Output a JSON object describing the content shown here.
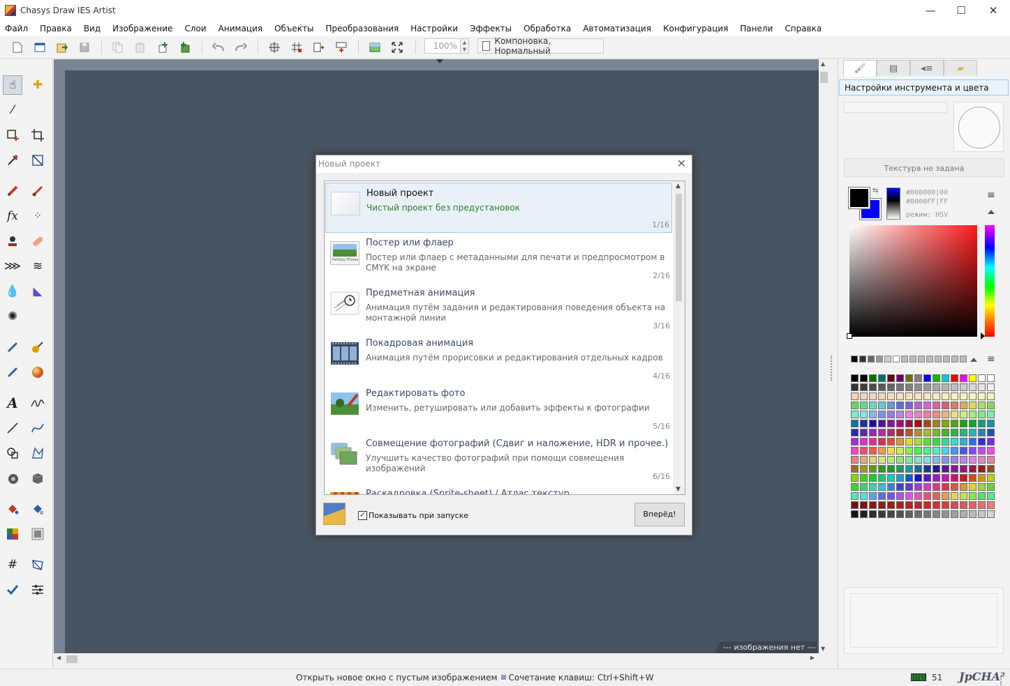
{
  "window": {
    "title": "Chasys Draw IES Artist",
    "minimize": "—",
    "maximize": "☐",
    "close": "✕"
  },
  "menu": [
    "Файл",
    "Правка",
    "Вид",
    "Изображение",
    "Слои",
    "Анимация",
    "Объекты",
    "Преобразования",
    "Настройки",
    "Эффекты",
    "Обработка",
    "Автоматизация",
    "Конфигурация",
    "Панели",
    "Справка"
  ],
  "toolbar": {
    "icons": [
      "new-file-icon",
      "open-window-icon",
      "import-icon",
      "save-icon",
      "copy-icon",
      "paste-icon",
      "new-layer-icon",
      "add-layer-icon",
      "undo-icon",
      "redo-icon",
      "grid-icon",
      "grid-add-icon",
      "layer-split-icon",
      "layer-merge-icon",
      "image-icon",
      "fit-screen-icon",
      "document-icon"
    ],
    "zoom": "100%",
    "mode": "Компоновка, Нормальный"
  },
  "tools": [
    "hand-icon",
    "plus-move-icon",
    "eyedropper-icon",
    "select-add-icon",
    "crop-icon",
    "pipette-icon",
    "transform-icon",
    "pencil-icon",
    "brush-icon",
    "fx-icon",
    "scatter-icon",
    "stamp-icon",
    "bandage-icon",
    "spray-icon",
    "wave-icon",
    "drop-icon",
    "cone-icon",
    "splash-icon",
    "marker-icon",
    "round-brush-icon",
    "blue-pen-icon",
    "sphere-icon",
    "text-icon",
    "signature-icon",
    "line-icon",
    "curve-icon",
    "shapes-icon",
    "polygon-icon",
    "camera-icon",
    "cube-icon",
    "fill-icon",
    "fill-pattern-icon",
    "gradient-icon",
    "gray-square-icon",
    "hash-grid-icon",
    "warp-icon",
    "check-brush-icon",
    "sliders-icon"
  ],
  "canvas": {
    "no_image": "--- изображения нет ---"
  },
  "statusbar": {
    "hint": "Открыть новое окно с пустым изображением",
    "shortcut": "Сочетание клавиш: Ctrl+Shift+W",
    "memory": "51",
    "brand": "JpCHA²"
  },
  "right_panel": {
    "tabs": [
      "tool-colors-icon",
      "layers-icon",
      "properties-icon",
      "folder-icon"
    ],
    "header": "Настройки инструмента и цвета",
    "texture": "Текстура не задана",
    "fg_hex": "#000000|00",
    "bg_hex": "#0000FF|FF",
    "mode": "режим: HSV",
    "colors": {
      "fg": "#000000",
      "bg": "#0000ff"
    }
  },
  "dialog": {
    "title": "Новый проект",
    "projects": [
      {
        "title": "Новый проект",
        "desc": "Чистый проект без предустановок",
        "num": "1/16",
        "icon": "blank-project-icon"
      },
      {
        "title": "Постер или флаер",
        "desc": "Постер или флаер с метаданными для печати и предпросмотром в CMYK на экране",
        "num": "2/16",
        "icon": "poster-icon",
        "thumb_text": "Holiday Photos"
      },
      {
        "title": "Предметная анимация",
        "desc": "Анимация путём задания и редактирования поведения объекта на монтажной линии",
        "num": "3/16",
        "icon": "object-animation-icon"
      },
      {
        "title": "Покадровая анимация",
        "desc": "Анимация путём прорисовки и редактирования отдельных кадров",
        "num": "4/16",
        "icon": "film-frames-icon"
      },
      {
        "title": "Редактировать фото",
        "desc": "Изменить, ретушировать или добавить эффекты к фотографии",
        "num": "5/16",
        "icon": "edit-photo-icon"
      },
      {
        "title": "Совмещение фотографий (Сдвиг и наложение, HDR и прочее.)",
        "desc": "Улучшить качество фотографий при помощи совмещения изображений",
        "num": "6/16",
        "icon": "photo-stack-icon"
      },
      {
        "title": "Раскадровка (Sprite-sheet) / Атлас текстур",
        "desc": "",
        "num": "",
        "icon": "sprite-sheet-icon"
      }
    ],
    "show_on_start": "Показывать при запуске",
    "show_checked": "✓",
    "next": "Вперёд!"
  }
}
